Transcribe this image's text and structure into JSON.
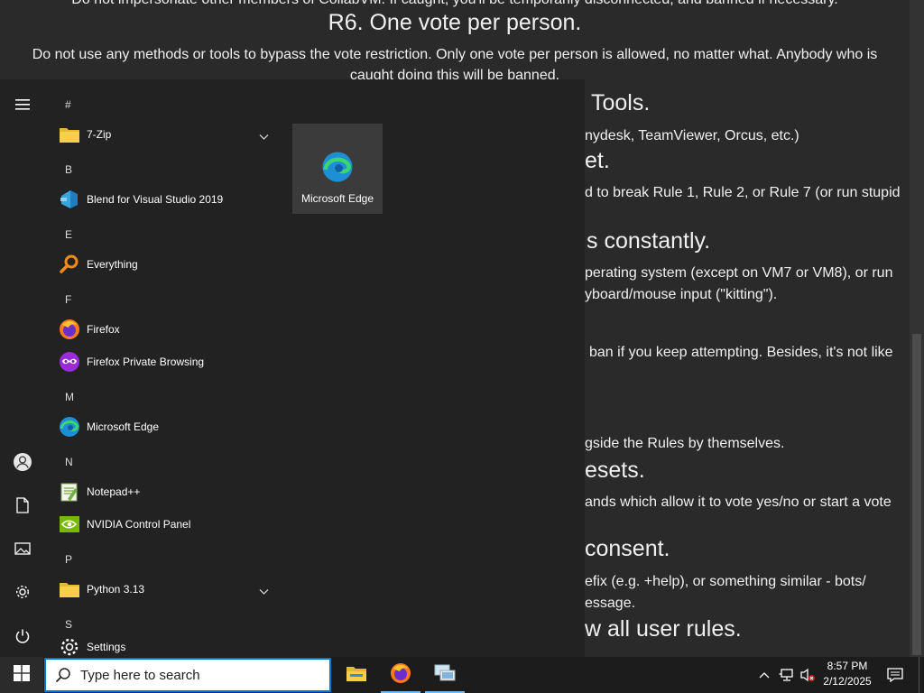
{
  "background_doc": {
    "lines": [
      {
        "text": "Do not impersonate other members of CollabVM. If caught, you'll be temporarily disconnected, and banned if necessary.",
        "kind": "p"
      },
      {
        "text": "R6. One vote per person.",
        "kind": "h"
      },
      {
        "text": "Do not use any methods or tools to bypass the vote restriction. Only one vote per person is allowed, no matter what. Anybody who is",
        "kind": "p"
      },
      {
        "text": "caught doing this will be banned.",
        "kind": "p"
      },
      {
        "text": "Tools.",
        "kind": "h"
      },
      {
        "text": "nydesk, TeamViewer, Orcus, etc.)",
        "kind": "p"
      },
      {
        "text": "et.",
        "kind": "h"
      },
      {
        "text": "d to break Rule 1, Rule 2, or Rule 7 (or run stupid",
        "kind": "p"
      },
      {
        "text": "s constantly.",
        "kind": "h"
      },
      {
        "text": "perating system (except on VM7 or VM8), or run",
        "kind": "p"
      },
      {
        "text": "yboard/mouse input (\"kitting\").",
        "kind": "p"
      },
      {
        "text": "ban if you keep attempting. Besides, it's not like",
        "kind": "p"
      },
      {
        "text": "gside the Rules by themselves.",
        "kind": "p"
      },
      {
        "text": "esets.",
        "kind": "h"
      },
      {
        "text": "ands which allow it to vote yes/no or start a vote",
        "kind": "p"
      },
      {
        "text": "consent.",
        "kind": "h"
      },
      {
        "text": "efix (e.g. +help), or something similar - bots/",
        "kind": "p"
      },
      {
        "text": "essage.",
        "kind": "p"
      },
      {
        "text": "w all user rules.",
        "kind": "h"
      }
    ]
  },
  "start_menu": {
    "rail": [
      {
        "name": "hamburger-menu-icon"
      },
      {
        "name": "user-account-icon"
      },
      {
        "name": "documents-icon"
      },
      {
        "name": "pictures-icon"
      },
      {
        "name": "settings-icon"
      },
      {
        "name": "power-icon"
      }
    ],
    "groups": [
      "#",
      "B",
      "E",
      "F",
      "M",
      "N",
      "P",
      "S"
    ],
    "apps": [
      {
        "label": "7-Zip",
        "icon": "folder-icon",
        "expandable": true
      },
      {
        "label": "Blend for Visual Studio 2019",
        "icon": "blend-icon"
      },
      {
        "label": "Everything",
        "icon": "magnifier-icon"
      },
      {
        "label": "Firefox",
        "icon": "firefox-icon"
      },
      {
        "label": "Firefox Private Browsing",
        "icon": "firefox-private-icon"
      },
      {
        "label": "Microsoft Edge",
        "icon": "edge-icon"
      },
      {
        "label": "Notepad++",
        "icon": "notepad-plus-plus-icon"
      },
      {
        "label": "NVIDIA Control Panel",
        "icon": "nvidia-icon"
      },
      {
        "label": "Python 3.13",
        "icon": "folder-icon",
        "expandable": true
      },
      {
        "label": "Settings",
        "icon": "gear-icon"
      }
    ],
    "tiles": [
      {
        "label": "Microsoft Edge",
        "icon": "edge-icon"
      }
    ]
  },
  "taskbar": {
    "search_placeholder": "Type here to search",
    "pinned": [
      {
        "name": "file-explorer-icon",
        "active": false
      },
      {
        "name": "firefox-icon",
        "active": true
      },
      {
        "name": "remote-desktop-icon",
        "active": true
      }
    ],
    "clock": {
      "time": "8:57 PM",
      "date": "2/12/2025"
    }
  },
  "colors": {
    "accent": "#0078d7",
    "taskbar": "#1c1c1c",
    "menu": "#222222",
    "folder": "#f3c53c",
    "nvidia": "#76b900"
  }
}
